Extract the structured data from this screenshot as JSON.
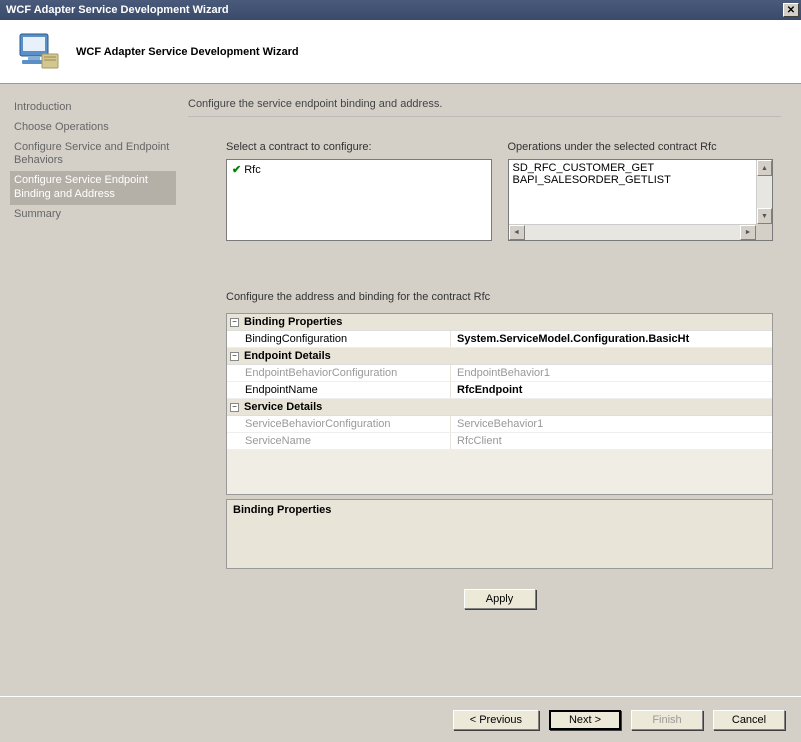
{
  "window": {
    "title": "WCF Adapter Service Development Wizard"
  },
  "header": {
    "title": "WCF Adapter Service Development Wizard"
  },
  "sidebar": {
    "items": [
      {
        "label": "Introduction"
      },
      {
        "label": "Choose Operations"
      },
      {
        "label": "Configure Service and Endpoint Behaviors"
      },
      {
        "label": "Configure Service Endpoint Binding and Address"
      },
      {
        "label": "Summary"
      }
    ],
    "active_index": 3
  },
  "main": {
    "heading": "Configure the service endpoint binding and address.",
    "contract_label": "Select a contract to configure:",
    "contracts": [
      {
        "name": "Rfc",
        "checked": true
      }
    ],
    "operations_label": "Operations under the selected contract  Rfc",
    "operations": [
      "SD_RFC_CUSTOMER_GET",
      "BAPI_SALESORDER_GETLIST"
    ],
    "config_label": "Configure the address and binding for the contract  Rfc",
    "grid": {
      "categories": [
        {
          "name": "Binding Properties",
          "rows": [
            {
              "key": "BindingConfiguration",
              "value": "System.ServiceModel.Configuration.BasicHt",
              "bold": true,
              "disabled": false
            }
          ]
        },
        {
          "name": "Endpoint Details",
          "rows": [
            {
              "key": "EndpointBehaviorConfiguration",
              "value": "EndpointBehavior1",
              "bold": false,
              "disabled": true
            },
            {
              "key": "EndpointName",
              "value": "RfcEndpoint",
              "bold": true,
              "disabled": false
            }
          ]
        },
        {
          "name": "Service Details",
          "rows": [
            {
              "key": "ServiceBehaviorConfiguration",
              "value": "ServiceBehavior1",
              "bold": false,
              "disabled": true
            },
            {
              "key": "ServiceName",
              "value": "RfcClient",
              "bold": false,
              "disabled": true
            }
          ]
        }
      ]
    },
    "description_title": "Binding Properties",
    "apply_label": "Apply"
  },
  "footer": {
    "previous": "< Previous",
    "next": "Next >",
    "finish": "Finish",
    "cancel": "Cancel"
  }
}
